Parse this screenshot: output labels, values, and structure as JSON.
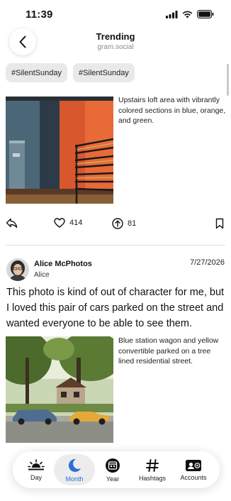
{
  "status": {
    "time": "11:39"
  },
  "header": {
    "title": "Trending",
    "subtitle": "gram.social"
  },
  "tags": [
    "#SilentSunday",
    "#SilentSunday"
  ],
  "post1": {
    "description": "Upstairs loft area with vibrantly colored sections in blue, orange, and green.",
    "likes": "414",
    "boosts": "81"
  },
  "post2": {
    "author_name": "Alice McPhotos",
    "author_handle": "Alice",
    "date": "7/27/2026",
    "text": "This photo is kind of out of character for me, but I loved this pair of cars parked on the street and wanted everyone to be able to see them.",
    "description": "Blue station wagon and yellow convertible parked on a tree lined residential street."
  },
  "tabs": [
    {
      "label": "Day",
      "icon": "sunrise-icon"
    },
    {
      "label": "Month",
      "icon": "moon-icon"
    },
    {
      "label": "Year",
      "icon": "calendar-circle-icon"
    },
    {
      "label": "Hashtags",
      "icon": "hashtag-icon"
    },
    {
      "label": "Accounts",
      "icon": "contact-card-icon"
    }
  ],
  "colors": {
    "accent": "#2b6fd6",
    "chip_bg": "#e9e9e9"
  }
}
